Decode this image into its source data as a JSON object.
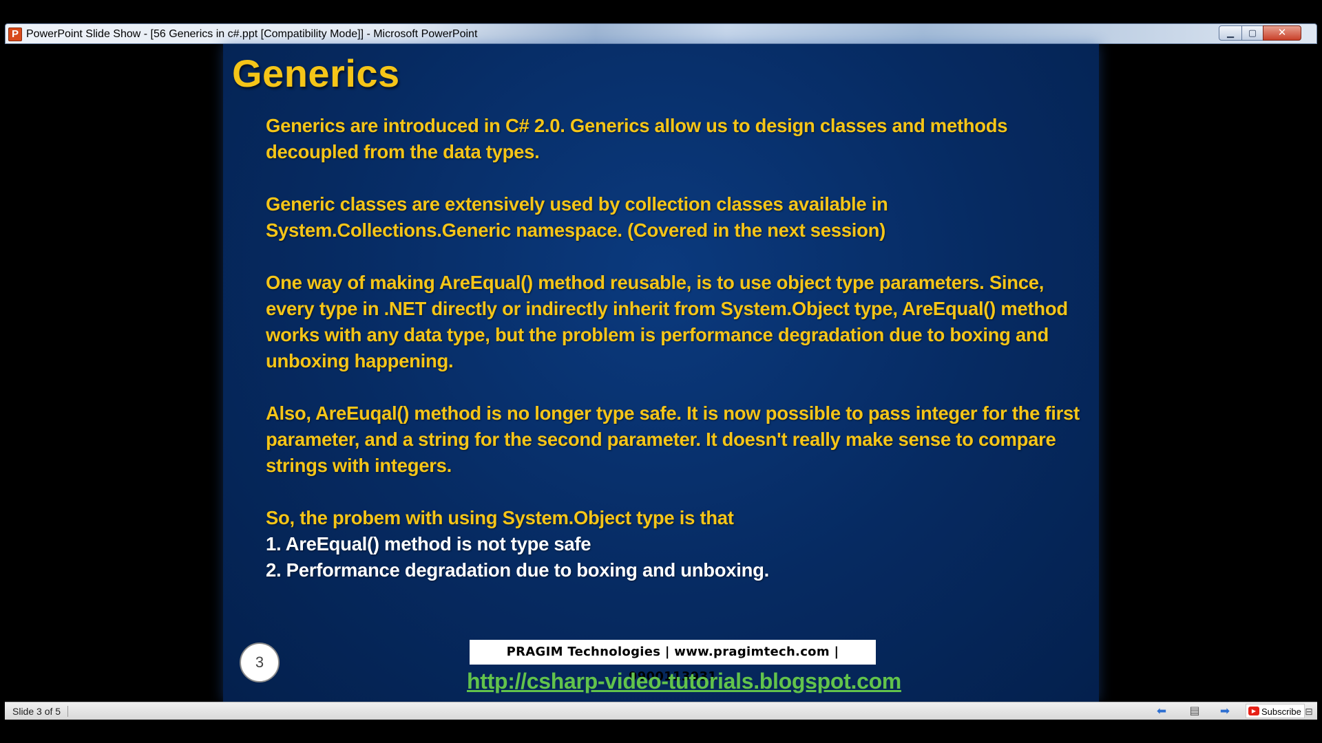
{
  "window": {
    "app_icon": "P",
    "title": "PowerPoint Slide Show - [56 Generics in c#.ppt [Compatibility Mode]] - Microsoft PowerPoint",
    "minimize_glyph": "▁",
    "maximize_glyph": "▢",
    "close_glyph": "✕"
  },
  "slide": {
    "title": "Generics",
    "paragraphs": [
      "Generics are introduced in C# 2.0. Generics allow us to design classes and methods decoupled from the data types.",
      "Generic classes are extensively used by collection classes available in System.Collections.Generic namespace. (Covered in the next session)",
      "One way of making AreEqual() method reusable, is to use object type parameters. Since, every type in .NET directly or indirectly inherit from System.Object type, AreEqual() method works with any data type, but the problem is performance degradation due to boxing and unboxing happening.",
      "Also, AreEuqal() method is no longer type safe. It is now possible to pass integer for the first parameter, and a string for the second parameter. It doesn't really make sense to compare strings with integers."
    ],
    "summary_intro": "So, the probem with using System.Object type is that",
    "summary_items": [
      "1. AreEqual() method is not type safe",
      "2. Performance degradation due to boxing and unboxing."
    ],
    "slide_number": "3",
    "footer_company": "PRAGIM Technologies | www.pragimtech.com | 9900113931",
    "footer_link": "http://csharp-video-tutorials.blogspot.com"
  },
  "statusbar": {
    "slide_indicator": "Slide 3 of 5",
    "prev_glyph": "⬅",
    "menu_glyph": "▤",
    "next_glyph": "➡",
    "subscribe_label": "Subscribe",
    "youtube_glyph": "▶",
    "zoom_glyph": "⊟"
  },
  "colors": {
    "title_yellow": "#f5c518",
    "body_white": "#ffffff",
    "link_green": "#62c34b",
    "slide_bg": "#062a61"
  }
}
